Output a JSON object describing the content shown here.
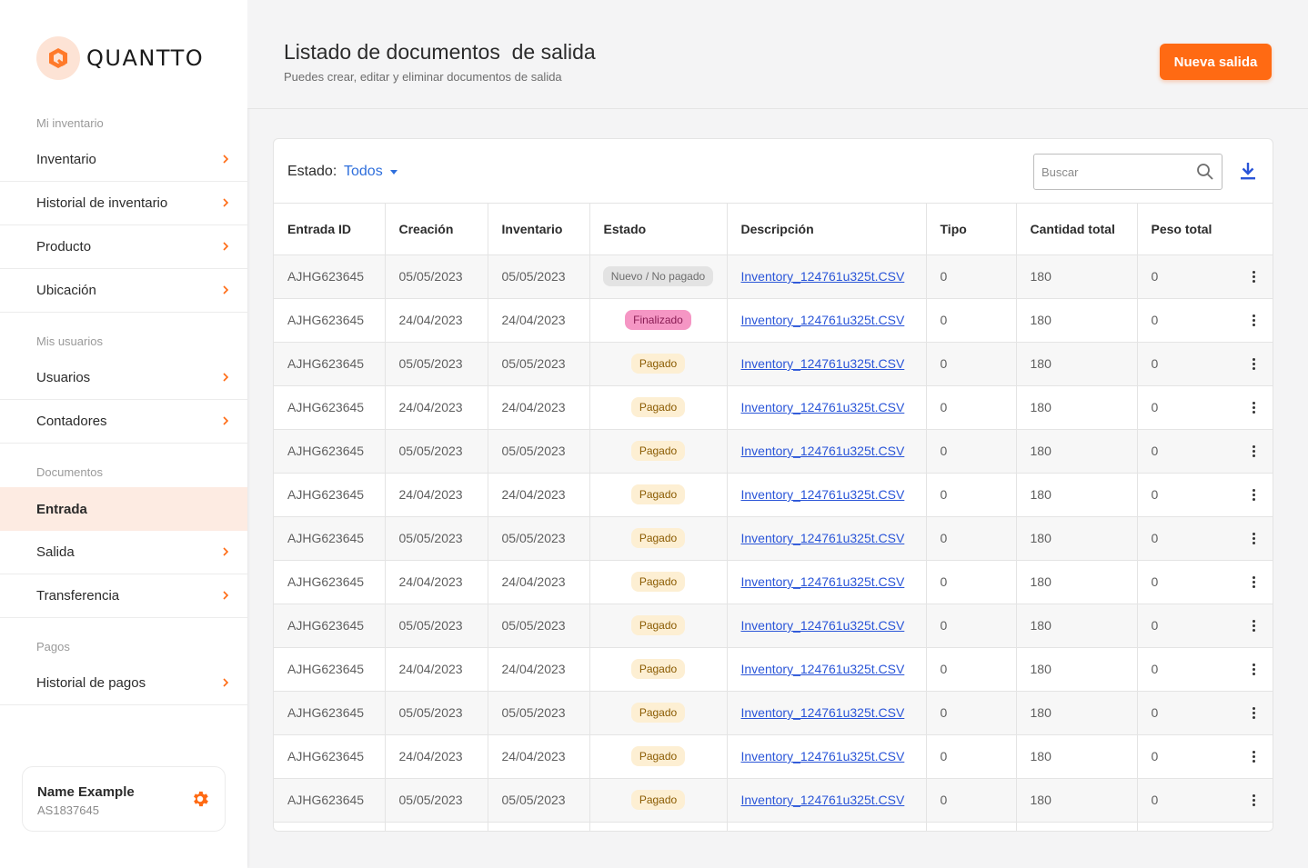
{
  "brand": {
    "name": "QUANTTO"
  },
  "sidebar": {
    "sections": [
      {
        "title": "Mi inventario",
        "items": [
          {
            "label": "Inventario",
            "active": false
          },
          {
            "label": "Historial de inventario",
            "active": false
          },
          {
            "label": "Producto",
            "active": false
          },
          {
            "label": "Ubicación",
            "active": false
          }
        ]
      },
      {
        "title": "Mis usuarios",
        "items": [
          {
            "label": "Usuarios",
            "active": false
          },
          {
            "label": "Contadores",
            "active": false
          }
        ]
      },
      {
        "title": "Documentos",
        "items": [
          {
            "label": "Entrada",
            "active": true
          },
          {
            "label": "Salida",
            "active": false
          },
          {
            "label": "Transferencia",
            "active": false
          }
        ]
      },
      {
        "title": "Pagos",
        "items": [
          {
            "label": "Historial de pagos",
            "active": false
          }
        ]
      }
    ],
    "user": {
      "name": "Name Example",
      "id": "AS1837645"
    }
  },
  "header": {
    "title": "Listado de documentos  de salida",
    "subtitle": "Puedes crear, editar y eliminar documentos de salida",
    "new_button": "Nueva salida"
  },
  "toolbar": {
    "filter_label": "Estado:",
    "filter_value": "Todos",
    "search_placeholder": "Buscar"
  },
  "colors": {
    "accent": "#ff6a13",
    "link": "#2a55d8",
    "filter": "#2f6fdc"
  },
  "table": {
    "columns": [
      "Entrada ID",
      "Creación",
      "Inventario",
      "Estado",
      "Descripción",
      "Tipo",
      "Cantidad total",
      "Peso total"
    ],
    "rows": [
      {
        "id": "AJHG623645",
        "creacion": "05/05/2023",
        "inventario": "05/05/2023",
        "estado": "Nuevo / No pagado",
        "estado_type": "nuevo",
        "descripcion": "Inventory_124761u325t.CSV",
        "tipo": "0",
        "cantidad": "180",
        "peso": "0"
      },
      {
        "id": "AJHG623645",
        "creacion": "24/04/2023",
        "inventario": "24/04/2023",
        "estado": "Finalizado",
        "estado_type": "finalizado",
        "descripcion": "Inventory_124761u325t.CSV",
        "tipo": "0",
        "cantidad": "180",
        "peso": "0"
      },
      {
        "id": "AJHG623645",
        "creacion": "05/05/2023",
        "inventario": "05/05/2023",
        "estado": "Pagado",
        "estado_type": "pagado",
        "descripcion": "Inventory_124761u325t.CSV",
        "tipo": "0",
        "cantidad": "180",
        "peso": "0"
      },
      {
        "id": "AJHG623645",
        "creacion": "24/04/2023",
        "inventario": "24/04/2023",
        "estado": "Pagado",
        "estado_type": "pagado",
        "descripcion": "Inventory_124761u325t.CSV",
        "tipo": "0",
        "cantidad": "180",
        "peso": "0"
      },
      {
        "id": "AJHG623645",
        "creacion": "05/05/2023",
        "inventario": "05/05/2023",
        "estado": "Pagado",
        "estado_type": "pagado",
        "descripcion": "Inventory_124761u325t.CSV",
        "tipo": "0",
        "cantidad": "180",
        "peso": "0"
      },
      {
        "id": "AJHG623645",
        "creacion": "24/04/2023",
        "inventario": "24/04/2023",
        "estado": "Pagado",
        "estado_type": "pagado",
        "descripcion": "Inventory_124761u325t.CSV",
        "tipo": "0",
        "cantidad": "180",
        "peso": "0"
      },
      {
        "id": "AJHG623645",
        "creacion": "05/05/2023",
        "inventario": "05/05/2023",
        "estado": "Pagado",
        "estado_type": "pagado",
        "descripcion": "Inventory_124761u325t.CSV",
        "tipo": "0",
        "cantidad": "180",
        "peso": "0"
      },
      {
        "id": "AJHG623645",
        "creacion": "24/04/2023",
        "inventario": "24/04/2023",
        "estado": "Pagado",
        "estado_type": "pagado",
        "descripcion": "Inventory_124761u325t.CSV",
        "tipo": "0",
        "cantidad": "180",
        "peso": "0"
      },
      {
        "id": "AJHG623645",
        "creacion": "05/05/2023",
        "inventario": "05/05/2023",
        "estado": "Pagado",
        "estado_type": "pagado",
        "descripcion": "Inventory_124761u325t.CSV",
        "tipo": "0",
        "cantidad": "180",
        "peso": "0"
      },
      {
        "id": "AJHG623645",
        "creacion": "24/04/2023",
        "inventario": "24/04/2023",
        "estado": "Pagado",
        "estado_type": "pagado",
        "descripcion": "Inventory_124761u325t.CSV",
        "tipo": "0",
        "cantidad": "180",
        "peso": "0"
      },
      {
        "id": "AJHG623645",
        "creacion": "05/05/2023",
        "inventario": "05/05/2023",
        "estado": "Pagado",
        "estado_type": "pagado",
        "descripcion": "Inventory_124761u325t.CSV",
        "tipo": "0",
        "cantidad": "180",
        "peso": "0"
      },
      {
        "id": "AJHG623645",
        "creacion": "24/04/2023",
        "inventario": "24/04/2023",
        "estado": "Pagado",
        "estado_type": "pagado",
        "descripcion": "Inventory_124761u325t.CSV",
        "tipo": "0",
        "cantidad": "180",
        "peso": "0"
      },
      {
        "id": "AJHG623645",
        "creacion": "05/05/2023",
        "inventario": "05/05/2023",
        "estado": "Pagado",
        "estado_type": "pagado",
        "descripcion": "Inventory_124761u325t.CSV",
        "tipo": "0",
        "cantidad": "180",
        "peso": "0"
      }
    ]
  }
}
